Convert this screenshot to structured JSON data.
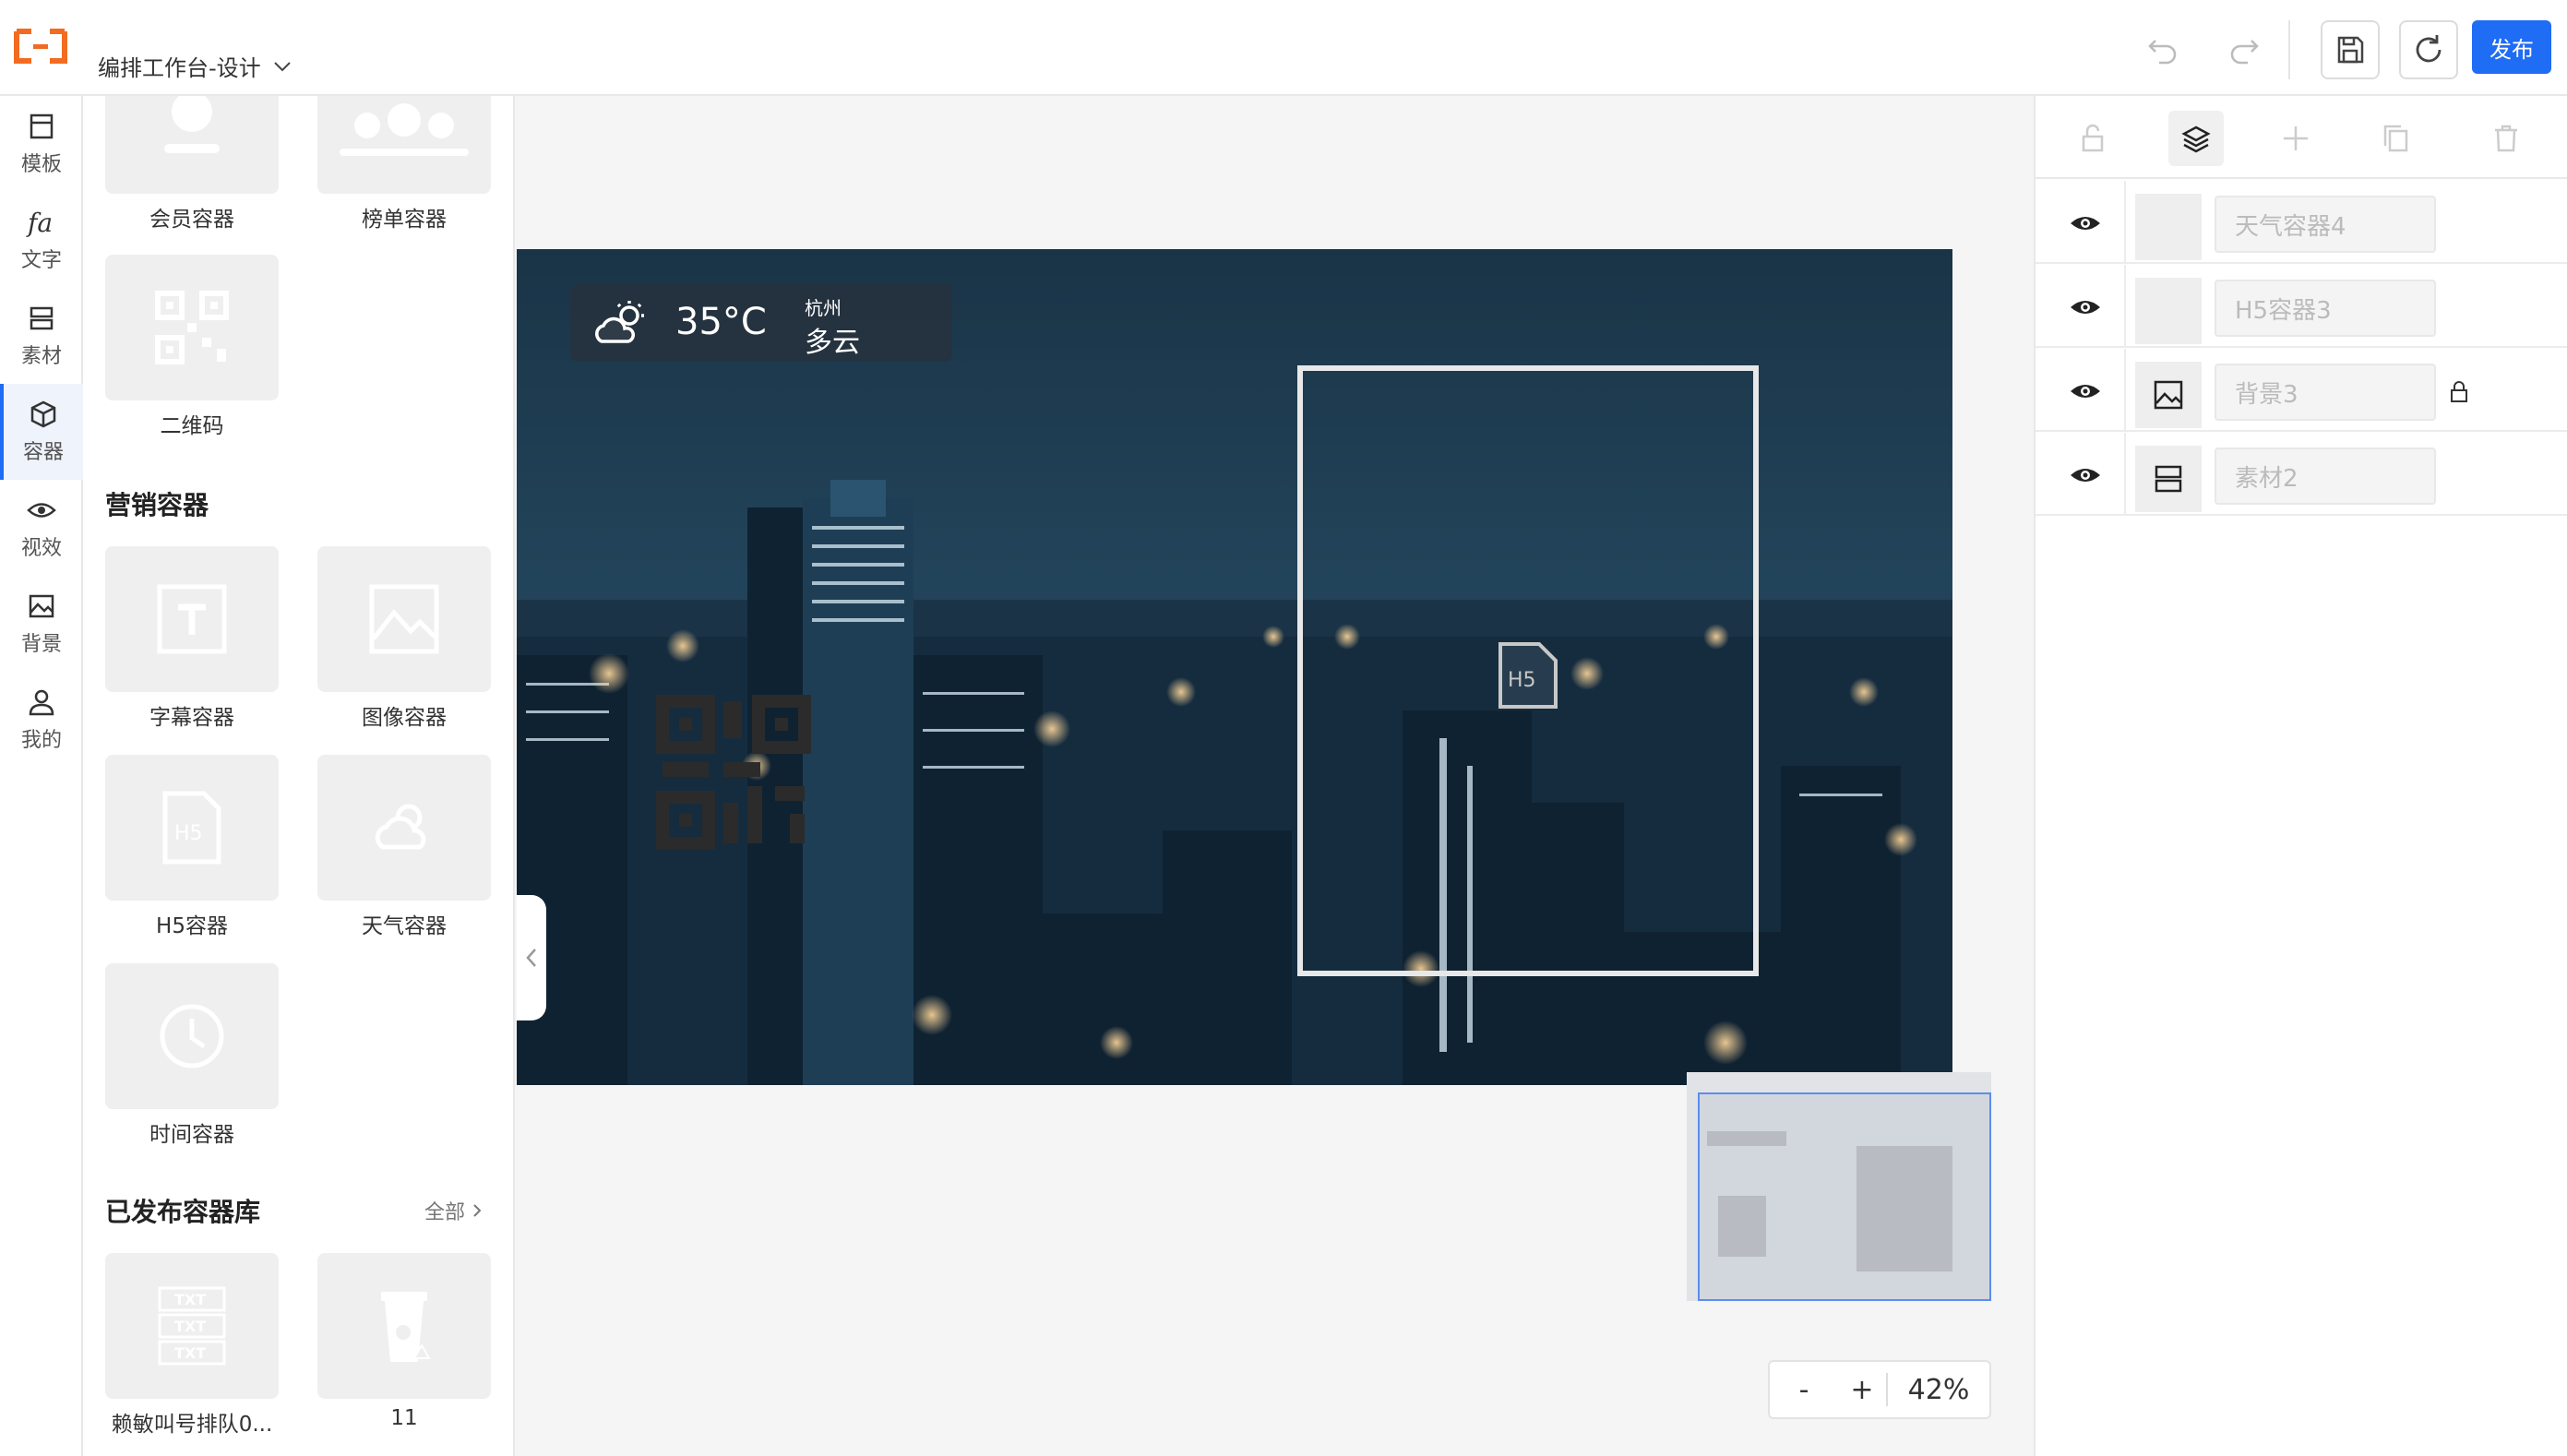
{
  "header": {
    "title": "编排工作台-设计",
    "publish_label": "发布",
    "icons": [
      "undo-icon",
      "redo-icon",
      "save-icon",
      "refresh-icon"
    ]
  },
  "rail": {
    "items": [
      {
        "label": "模板",
        "icon": "template-icon"
      },
      {
        "label": "文字",
        "icon": "text-icon"
      },
      {
        "label": "素材",
        "icon": "material-icon"
      },
      {
        "label": "容器",
        "icon": "container-icon",
        "active": true
      },
      {
        "label": "视效",
        "icon": "visual-effect-icon"
      },
      {
        "label": "背景",
        "icon": "background-icon"
      },
      {
        "label": "我的",
        "icon": "user-icon"
      }
    ]
  },
  "panel": {
    "top_cards": [
      "会员容器",
      "榜单容器",
      "二维码"
    ],
    "marketing_title": "营销容器",
    "marketing_cards": [
      "字幕容器",
      "图像容器",
      "H5容器",
      "天气容器",
      "时间容器"
    ],
    "published_title": "已发布容器库",
    "all_label": "全部",
    "published_cards": [
      "赖敏叫号排队0...",
      "11"
    ]
  },
  "canvas": {
    "weather": {
      "temp": "35°C",
      "city": "杭州",
      "condition": "多云"
    },
    "h5_label": "H5",
    "zoom": {
      "minus": "-",
      "plus": "+",
      "level": "42%"
    }
  },
  "layers": {
    "tools": [
      "unlock-icon",
      "layers-icon",
      "add-icon",
      "copy-icon",
      "delete-icon"
    ],
    "items": [
      {
        "name": "天气容器4",
        "thumb": "blank"
      },
      {
        "name": "H5容器3",
        "thumb": "blank"
      },
      {
        "name": "背景3",
        "thumb": "image-icon",
        "locked": true
      },
      {
        "name": "素材2",
        "thumb": "material-icon"
      }
    ]
  },
  "colors": {
    "accent": "#1f6cf5",
    "logo": "#f26b21"
  }
}
